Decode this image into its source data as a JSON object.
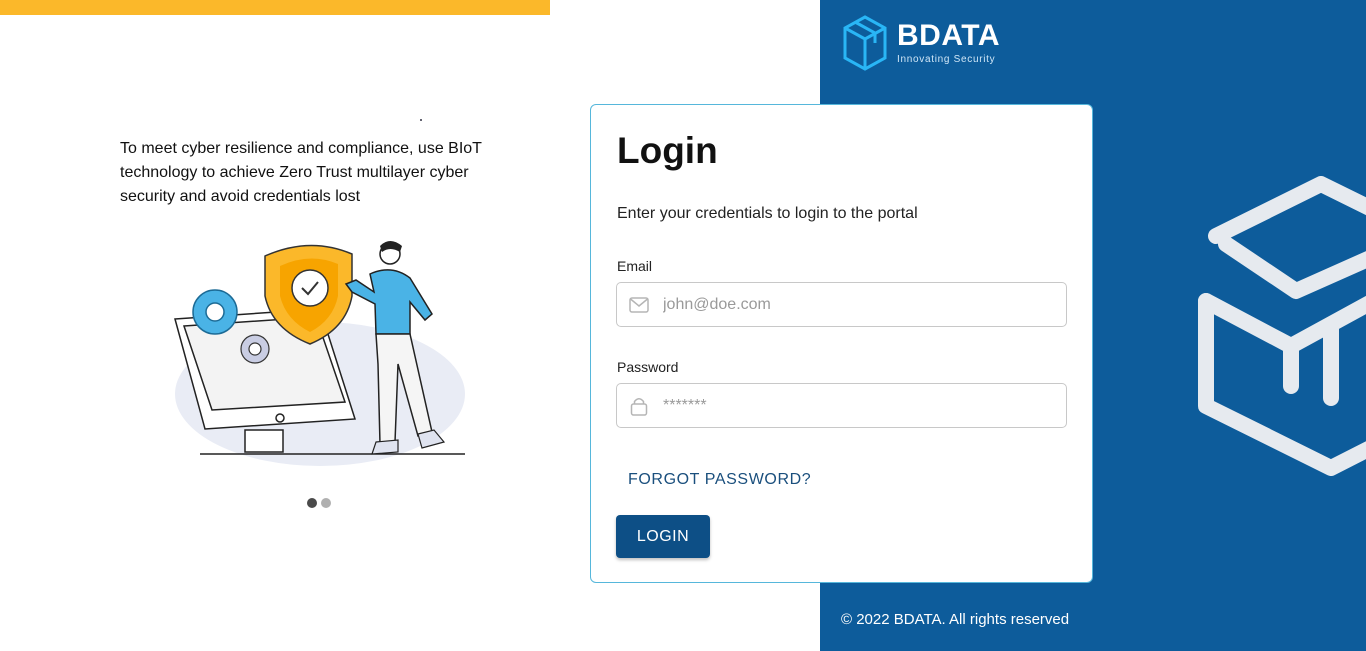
{
  "left": {
    "tagline": "To meet cyber resilience and compliance, use BIoT technology to achieve Zero Trust multilayer cyber security and avoid credentials lost",
    "carousel": {
      "count": 2,
      "active": 0
    }
  },
  "brand": {
    "name": "BDATA",
    "tagline": "Innovating Security"
  },
  "login": {
    "title": "Login",
    "subtitle": "Enter your credentials to login to the portal",
    "email_label": "Email",
    "email_placeholder": "john@doe.com",
    "email_icon": "mail-icon",
    "password_label": "Password",
    "password_placeholder": "*******",
    "password_icon": "lock-icon",
    "forgot_label": "FORGOT PASSWORD?",
    "submit_label": "LOGIN"
  },
  "footer": {
    "copyright": "© 2022 BDATA. All rights reserved"
  },
  "colors": {
    "brand_blue": "#0d5c9b",
    "accent_yellow": "#fbb82a",
    "button_blue": "#0d4f86",
    "card_border": "#56b7db"
  }
}
